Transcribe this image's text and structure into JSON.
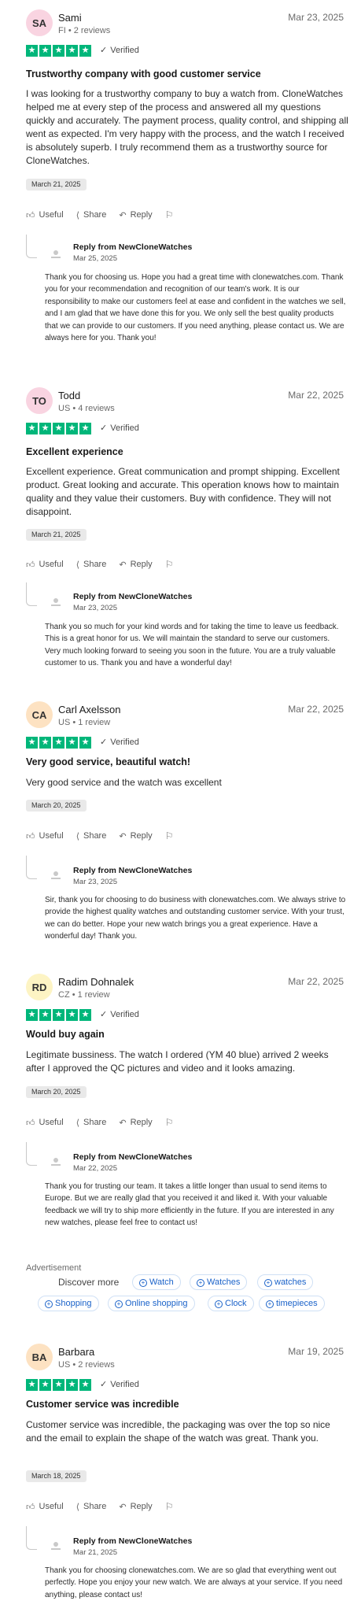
{
  "colors": {
    "star_green": "#00b67a",
    "link_blue": "#1a62c9"
  },
  "labels": {
    "verified": "Verified",
    "useful": "Useful",
    "share": "Share",
    "reply": "Reply"
  },
  "reviews": [
    {
      "initials": "SA",
      "avatar_color": "#f9d4e1",
      "name": "Sami",
      "meta": "FI • 2 reviews",
      "date": "Mar 23, 2025",
      "title": "Trustworthy company with good customer service",
      "body": "I was looking for a trustworthy company to buy a watch from. CloneWatches helped me at every step of the process and answered all my questions quickly and accurately. The payment process, quality control, and shipping all went as expected. I'm very happy with the process, and the watch I received is absolutely superb. I truly recommend them as a trustworthy source for CloneWatches.",
      "experience_date": "March 21, 2025",
      "reply_from": "Reply from NewCloneWatches",
      "reply_date": "Mar 25, 2025",
      "reply_body": "Thank you for choosing us. Hope you had a great time with clonewatches.com. Thank you for your recommendation and recognition of our team's work. It is our responsibility to make our customers feel at ease and confident in the watches we sell, and I am glad that we have done this for you. We only sell the best quality products that we can provide to our customers. If you need anything, please contact us. We are always here for you. Thank you!"
    },
    {
      "initials": "TO",
      "avatar_color": "#f9d4e1",
      "name": "Todd",
      "meta": "US • 4 reviews",
      "date": "Mar 22, 2025",
      "title": "Excellent experience",
      "body": "Excellent experience. Great communication and prompt shipping. Excellent product. Great looking and accurate. This operation knows how to maintain quality and they value their customers. Buy with confidence. They will not disappoint.",
      "experience_date": "March 21, 2025",
      "reply_from": "Reply from NewCloneWatches",
      "reply_date": "Mar 23, 2025",
      "reply_body": "Thank you so much for your kind words and for taking the time to leave us feedback. This is a great honor for us. We will maintain the standard to serve our customers. Very much looking forward to seeing you soon in the future. You are a truly valuable customer to us. Thank you and have a wonderful day!"
    },
    {
      "initials": "CA",
      "avatar_color": "#fde2c2",
      "name": "Carl Axelsson",
      "meta": "US • 1 review",
      "date": "Mar 22, 2025",
      "title": "Very good service, beautiful watch!",
      "body": "Very good service and the watch was excellent",
      "experience_date": "March 20, 2025",
      "reply_from": "Reply from NewCloneWatches",
      "reply_date": "Mar 23, 2025",
      "reply_body": "Sir, thank you for choosing to do business with clonewatches.com. We always strive to provide the highest quality watches and outstanding customer service. With your trust, we can do better. Hope your new watch brings you a great experience. Have a wonderful day! Thank you."
    },
    {
      "initials": "RD",
      "avatar_color": "#fdf4c4",
      "name": "Radim Dohnalek",
      "meta": "CZ • 1 review",
      "date": "Mar 22, 2025",
      "title": "Would buy again",
      "body": "Legitimate bussiness. The watch I ordered (YM 40 blue) arrived 2 weeks after I approved the QC pictures and video and it looks amazing.",
      "experience_date": "March 20, 2025",
      "reply_from": "Reply from NewCloneWatches",
      "reply_date": "Mar 22, 2025",
      "reply_body": "Thank you for trusting our team. It takes a little longer than usual to send items to Europe. But we are really glad that you received it and liked it. With your valuable feedback we will try to ship more efficiently in the future. If you are interested in any new watches, please feel free to contact us!"
    },
    {
      "initials": "BA",
      "avatar_color": "#fde2c2",
      "name": "Barbara",
      "meta": "US • 2 reviews",
      "date": "Mar 19, 2025",
      "title": "Customer service was incredible",
      "body": "Customer service was incredible, the packaging was over the top so nice and the email to explain the shape of the watch was great. Thank you.",
      "experience_date": "March 18, 2025",
      "reply_from": "Reply from NewCloneWatches",
      "reply_date": "Mar 21, 2025",
      "reply_body": "Thank you for choosing clonewatches.com. We are so glad that everything went out perfectly. Hope you enjoy your new watch. We are always at your service. If you need anything, please contact us!"
    }
  ],
  "advertisement": {
    "label": "Advertisement",
    "discover": "Discover more",
    "pills": [
      "Watch",
      "Watches",
      "watches",
      "Shopping",
      "Online shopping",
      "Clock",
      "timepieces"
    ]
  }
}
